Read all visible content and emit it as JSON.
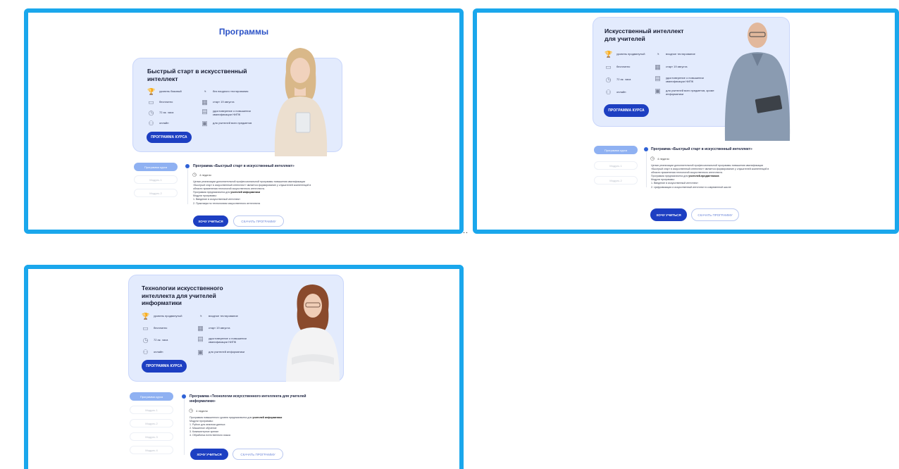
{
  "separator": "..",
  "panels": [
    {
      "page_title": "Программы",
      "card": {
        "title": "Быстрый старт в искусственный интеллект",
        "features_left": [
          {
            "icon": "trophy-icon",
            "glyph": "🏆",
            "text": "уровень базовый"
          },
          {
            "icon": "wallet-icon",
            "glyph": "▭",
            "text": "бесплатно"
          },
          {
            "icon": "clock-icon",
            "glyph": "◷",
            "text": "72 ак. часа"
          },
          {
            "icon": "group-icon",
            "glyph": "⚇",
            "text": "онлайн"
          }
        ],
        "features_right": [
          {
            "icon": "signal-icon",
            "glyph": "◔",
            "text": "без входного тестирования"
          },
          {
            "icon": "calendar-icon",
            "glyph": "▦",
            "text": "старт 19 августа"
          },
          {
            "icon": "certificate-icon",
            "glyph": "▤",
            "text": "удостоверение о повышении квалификации НИПК"
          },
          {
            "icon": "teacher-icon",
            "glyph": "▣",
            "text": "для учителей всех предметов"
          }
        ],
        "button": "ПРОГРАММА КУРСА"
      },
      "tabs": [
        "Программа курса",
        "Модуль 1",
        "Модуль 2"
      ],
      "program_title": "Программа «Быстрый старт в искусственный интеллект»",
      "duration": "4 недели",
      "description": [
        "Целью реализации дополнительной профессиональной программы повышения квалификации",
        "«Быстрый старт в искусственный интеллект» является формирование у слушателей компетенций в",
        "области применения технологий искусственного интеллекта.",
        "Программа предназначена для ",
        "учителей информатики",
        "Модули программы:",
        "1. Введение в искусственный интеллект",
        "2. Практикум по технологиям искусственного интеллекта"
      ],
      "button_want": "ХОЧУ УЧИТЬСЯ",
      "button_download": "СКАЧАТЬ ПРОГРАММУ"
    },
    {
      "card": {
        "title": "Искусственный интеллект для учителей",
        "features_left": [
          {
            "icon": "trophy-icon",
            "glyph": "🏆",
            "text": "уровень продвинутый"
          },
          {
            "icon": "wallet-icon",
            "glyph": "▭",
            "text": "бесплатно"
          },
          {
            "icon": "clock-icon",
            "glyph": "◷",
            "text": "72 ак. часа"
          },
          {
            "icon": "group-icon",
            "glyph": "⚇",
            "text": "онлайн"
          }
        ],
        "features_right": [
          {
            "icon": "signal-icon",
            "glyph": "◔",
            "text": "входное тестирование"
          },
          {
            "icon": "calendar-icon",
            "glyph": "▦",
            "text": "старт 19 августа"
          },
          {
            "icon": "certificate-icon",
            "glyph": "▤",
            "text": "удостоверение о повышении квалификации НИПК"
          },
          {
            "icon": "teacher-icon",
            "glyph": "▣",
            "text": "для учителей всех предметов, кроме информатики"
          }
        ],
        "button": "ПРОГРАММА КУРСА"
      },
      "tabs": [
        "Программа курса",
        "Модуль 1",
        "Модуль 2"
      ],
      "program_title": "Программа «Быстрый старт в искусственный интеллект»",
      "duration": "4 недели",
      "description": [
        "Целью реализации дополнительной профессиональной программы повышения квалификации",
        "«Быстрый старт в искусственный интеллект» является формирование у слушателей компетенций в",
        "области применения технологий искусственного интеллекта.",
        "Программа предназначена для ",
        "учителей-предметников",
        "Модули программы:",
        "1. Введение в искусственный интеллект",
        "2. Цифровизация и искусственный интеллект в современной школе"
      ],
      "button_want": "ХОЧУ УЧИТЬСЯ",
      "button_download": "СКАЧАТЬ ПРОГРАММУ"
    },
    {
      "card": {
        "title": "Технологии искусственного интеллекта для учителей информатики",
        "features_left": [
          {
            "icon": "trophy-icon",
            "glyph": "🏆",
            "text": "уровень продвинутый"
          },
          {
            "icon": "wallet-icon",
            "glyph": "▭",
            "text": "бесплатно"
          },
          {
            "icon": "clock-icon",
            "glyph": "◷",
            "text": "72 ак. часа"
          },
          {
            "icon": "group-icon",
            "glyph": "⚇",
            "text": "онлайн"
          }
        ],
        "features_right": [
          {
            "icon": "signal-icon",
            "glyph": "◔",
            "text": "входное тестирование"
          },
          {
            "icon": "calendar-icon",
            "glyph": "▦",
            "text": "старт 19 августа"
          },
          {
            "icon": "certificate-icon",
            "glyph": "▤",
            "text": "удостоверение о повышении квалификации НИПК"
          },
          {
            "icon": "teacher-icon",
            "glyph": "▣",
            "text": "для учителей информатики"
          }
        ],
        "button": "ПРОГРАММА КУРСА"
      },
      "tabs": [
        "Программа курса",
        "Модуль 1",
        "Модуль 2",
        "Модуль 3",
        "Модуль 4"
      ],
      "program_title": "Программа «Технологии искусственного интеллекта для учителей информатики»",
      "duration": "4 недели",
      "description": [
        "Программа повышенного уровня предназначена для ",
        "учителей информатики",
        "Модули программы:",
        "1. Python для анализа данных",
        "2. Машинное обучение",
        "3. Компьютерное зрение",
        "4. Обработка естественного языка"
      ],
      "button_want": "ХОЧУ УЧИТЬСЯ",
      "button_download": "СКАЧАТЬ ПРОГРАММУ"
    }
  ]
}
